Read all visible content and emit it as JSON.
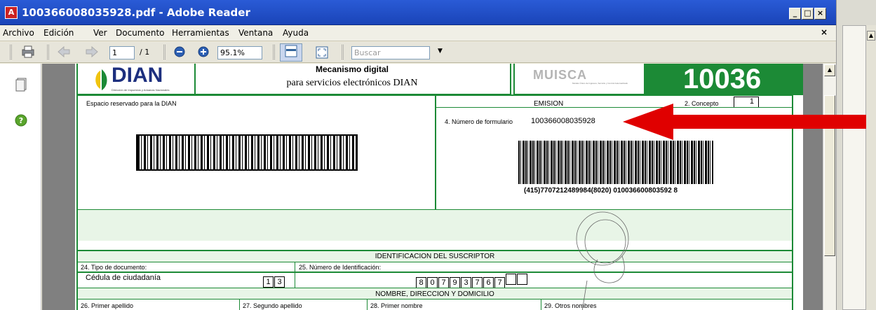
{
  "window": {
    "title": "100366008035928.pdf - Adobe Reader",
    "pdf_icon_glyph": "A",
    "minimize_glyph": "_",
    "maximize_glyph": "□",
    "close_glyph": "×"
  },
  "menubar": {
    "items": [
      "Archivo",
      "Edición",
      "Ver",
      "Documento",
      "Herramientas",
      "Ventana",
      "Ayuda"
    ],
    "close_glyph": "×"
  },
  "toolbar": {
    "page_current": "1",
    "page_total": "/ 1",
    "zoom": "95.1%",
    "search_placeholder": "Buscar"
  },
  "document": {
    "logo_text": "DIAN",
    "logo_subtext": "Dirección de Impuestos y Aduanas Nacionales",
    "header_line1": "Mecanismo digital",
    "header_line2": "para servicios electrónicos DIAN",
    "muisca_text": "MUISCA",
    "muisca_subtext": "Modelo Único de Ingresos, Servicio y Control Automatizado",
    "form_number_big": "10036",
    "reserved_label": "Espacio reservado para la DIAN",
    "emision_label": "EMISION",
    "concepto_label": "2. Concepto",
    "concepto_value": "1",
    "form_number_label": "4. Número de formulario",
    "form_number_value": "100366008035928",
    "barcode_text": "(415)7707212489984(8020) 010036600803592 8",
    "section_suscriptor": "IDENTIFICACION DEL SUSCRIPTOR",
    "tipo_doc_label": "24. Tipo de documento:",
    "tipo_doc_value": "Cédula de ciudadanía",
    "tipo_doc_code": [
      "1",
      "3"
    ],
    "id_label": "25. Número de Identificación:",
    "id_digits": [
      "8",
      "0",
      "7",
      "9",
      "3",
      "7",
      "6",
      "7",
      "",
      ""
    ],
    "section_nombre": "NOMBRE, DIRECCION Y DOMICILIO",
    "apellido1_label": "26. Primer apellido",
    "apellido2_label": "27. Segundo apellido",
    "nombre1_label": "28. Primer nombre",
    "otros_label": "29. Otros nombres"
  },
  "colors": {
    "form_green": "#1c8a36",
    "arrow_red": "#e00000",
    "title_blue": "#1a44b8"
  }
}
